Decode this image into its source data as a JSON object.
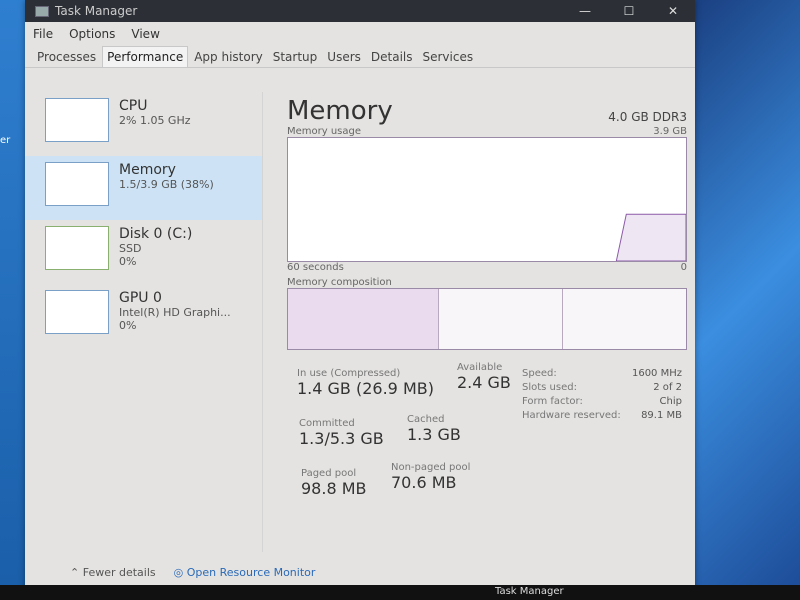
{
  "desktop_text": "er",
  "window": {
    "title": "Task Manager",
    "controls": [
      "—",
      "☐",
      "✕"
    ]
  },
  "menu": [
    "File",
    "Options",
    "View"
  ],
  "tabs": [
    {
      "label": "Processes"
    },
    {
      "label": "Performance",
      "active": true
    },
    {
      "label": "App history"
    },
    {
      "label": "Startup"
    },
    {
      "label": "Users"
    },
    {
      "label": "Details"
    },
    {
      "label": "Services"
    }
  ],
  "sidebar": [
    {
      "name": "CPU",
      "sub1": "2% 1.05 GHz",
      "sub2": ""
    },
    {
      "name": "Memory",
      "sub1": "1.5/3.9 GB (38%)",
      "sub2": "",
      "selected": true
    },
    {
      "name": "Disk 0 (C:)",
      "sub1": "SSD",
      "sub2": "0%"
    },
    {
      "name": "GPU 0",
      "sub1": "Intel(R) HD Graphi...",
      "sub2": "0%"
    }
  ],
  "main": {
    "title": "Memory",
    "spec": "4.0 GB DDR3",
    "usage_label": "Memory usage",
    "usage_max": "3.9 GB",
    "time_label": "60 seconds",
    "time_min": "0",
    "composition_label": "Memory composition",
    "usage_percent": 38,
    "stats": {
      "in_use_label": "In use (Compressed)",
      "in_use": "1.4 GB (26.9 MB)",
      "available_label": "Available",
      "available": "2.4 GB",
      "committed_label": "Committed",
      "committed": "1.3/5.3 GB",
      "cached_label": "Cached",
      "cached": "1.3 GB",
      "paged_label": "Paged pool",
      "paged": "98.8 MB",
      "nonpaged_label": "Non-paged pool",
      "nonpaged": "70.6 MB"
    },
    "props": [
      {
        "k": "Speed:",
        "v": "1600 MHz"
      },
      {
        "k": "Slots used:",
        "v": "2 of 2"
      },
      {
        "k": "Form factor:",
        "v": "Chip"
      },
      {
        "k": "Hardware reserved:",
        "v": "89.1 MB"
      }
    ]
  },
  "footer": {
    "fewer": "Fewer details",
    "monitor": "Open Resource Monitor"
  },
  "taskbar": {
    "app": "Task Manager"
  },
  "colors": {
    "accent": "#cde3f5",
    "graph_border": "#9a8aa8"
  }
}
